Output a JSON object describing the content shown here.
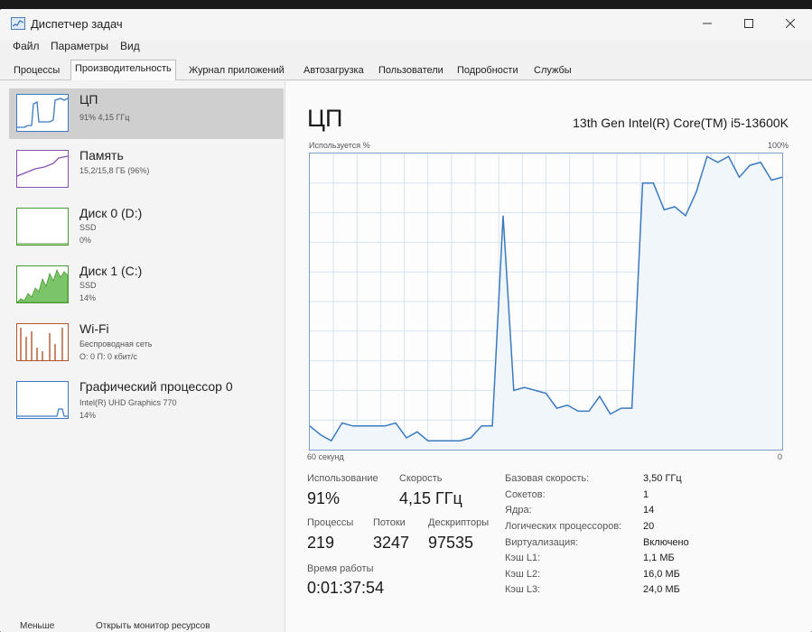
{
  "window": {
    "title": "Диспетчер задач"
  },
  "menu": [
    "Файл",
    "Параметры",
    "Вид"
  ],
  "tabs": [
    "Процессы",
    "Производительность",
    "Журнал приложений",
    "Автозагрузка",
    "Пользователи",
    "Подробности",
    "Службы"
  ],
  "active_tab": "Производительность",
  "sidebar": {
    "items": [
      {
        "name": "ЦП",
        "lines": [
          "91% 4,15 ГГц"
        ],
        "color": "#3b7ac2"
      },
      {
        "name": "Память",
        "lines": [
          "15,2/15,8 ГБ (96%)"
        ],
        "color": "#8a4fb3"
      },
      {
        "name": "Диск 0 (D:)",
        "lines": [
          "SSD",
          "0%"
        ],
        "color": "#4a9a2f"
      },
      {
        "name": "Диск 1 (C:)",
        "lines": [
          "SSD",
          "14%"
        ],
        "color": "#4a9a2f"
      },
      {
        "name": "Wi-Fi",
        "lines": [
          "Беспроводная сеть",
          "О: 0 П: 0 кбит/с"
        ],
        "color": "#b3542a"
      },
      {
        "name": "Графический процессор 0",
        "lines": [
          "Intel(R) UHD Graphics 770",
          "14%"
        ],
        "color": "#3b7ac2"
      }
    ]
  },
  "main": {
    "title": "ЦП",
    "model": "13th Gen Intel(R) Core(TM) i5-13600K",
    "graph_label_left": "Используется %",
    "graph_label_right": "100%",
    "axis_left": "60 секунд",
    "axis_right": "0",
    "stats": {
      "usage_label": "Использование",
      "usage_value": "91%",
      "speed_label": "Скорость",
      "speed_value": "4,15 ГГц",
      "processes_label": "Процессы",
      "processes_value": "219",
      "threads_label": "Потоки",
      "threads_value": "3247",
      "handles_label": "Дескрипторы",
      "handles_value": "97535",
      "uptime_label": "Время работы",
      "uptime_value": "0:01:37:54"
    },
    "details": [
      {
        "label": "Базовая скорость:",
        "value": "3,50 ГГц"
      },
      {
        "label": "Сокетов:",
        "value": "1"
      },
      {
        "label": "Ядра:",
        "value": "14"
      },
      {
        "label": "Логических процессоров:",
        "value": "20"
      },
      {
        "label": "Виртуализация:",
        "value": "Включено"
      },
      {
        "label": "Кэш L1:",
        "value": "1,1 МБ"
      },
      {
        "label": "Кэш L2:",
        "value": "16,0 МБ"
      },
      {
        "label": "Кэш L3:",
        "value": "24,0 МБ"
      }
    ]
  },
  "footer": {
    "less": "Меньше",
    "resource_monitor": "Открыть монитор ресурсов"
  },
  "chart_data": {
    "type": "line",
    "xlim": [
      60,
      0
    ],
    "ylim": [
      0,
      100
    ],
    "grid": true,
    "y": [
      8,
      5,
      3,
      9,
      8,
      8,
      8,
      8,
      9,
      4,
      6,
      3,
      3,
      3,
      3,
      4,
      8,
      8,
      79,
      20,
      21,
      20,
      19,
      14,
      15,
      13,
      13,
      18,
      12,
      14,
      14,
      90,
      90,
      81,
      82,
      79,
      87,
      99,
      97,
      99,
      92,
      96,
      97,
      91,
      92
    ]
  }
}
